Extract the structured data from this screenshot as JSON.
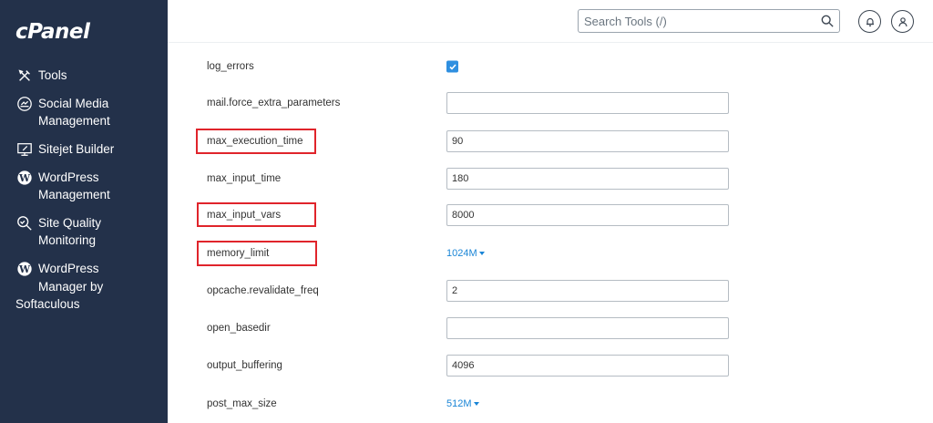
{
  "sidebar": {
    "logo": "cPanel",
    "items": [
      {
        "label": "Tools",
        "icon": "tools-icon"
      },
      {
        "label": "Social Media\nManagement",
        "icon": "social-media-icon"
      },
      {
        "label": "Sitejet Builder",
        "icon": "sitejet-icon"
      },
      {
        "label": "WordPress\nManagement",
        "icon": "wordpress-icon"
      },
      {
        "label": "Site Quality\nMonitoring",
        "icon": "site-quality-icon"
      },
      {
        "label_line1": "WordPress",
        "label_line2": "Manager by",
        "label_line3": "Softaculous",
        "icon": "wordpress-icon"
      }
    ]
  },
  "header": {
    "search_placeholder": "Search Tools (/)"
  },
  "settings": [
    {
      "name": "log_errors",
      "type": "checkbox",
      "checked": true
    },
    {
      "name": "mail.force_extra_parameters",
      "type": "text",
      "value": ""
    },
    {
      "name": "max_execution_time",
      "type": "text",
      "value": "90",
      "highlighted": true
    },
    {
      "name": "max_input_time",
      "type": "text",
      "value": "180"
    },
    {
      "name": "max_input_vars",
      "type": "text",
      "value": "8000",
      "highlighted": true
    },
    {
      "name": "memory_limit",
      "type": "dropdown",
      "value": "1024M",
      "highlighted": true
    },
    {
      "name": "opcache.revalidate_freq",
      "type": "text",
      "value": "2"
    },
    {
      "name": "open_basedir",
      "type": "text",
      "value": ""
    },
    {
      "name": "output_buffering",
      "type": "text",
      "value": "4096"
    },
    {
      "name": "post_max_size",
      "type": "dropdown",
      "value": "512M"
    }
  ],
  "colors": {
    "sidebar_bg": "#23314a",
    "accent": "#1a85d6",
    "highlight": "#e0242b"
  }
}
